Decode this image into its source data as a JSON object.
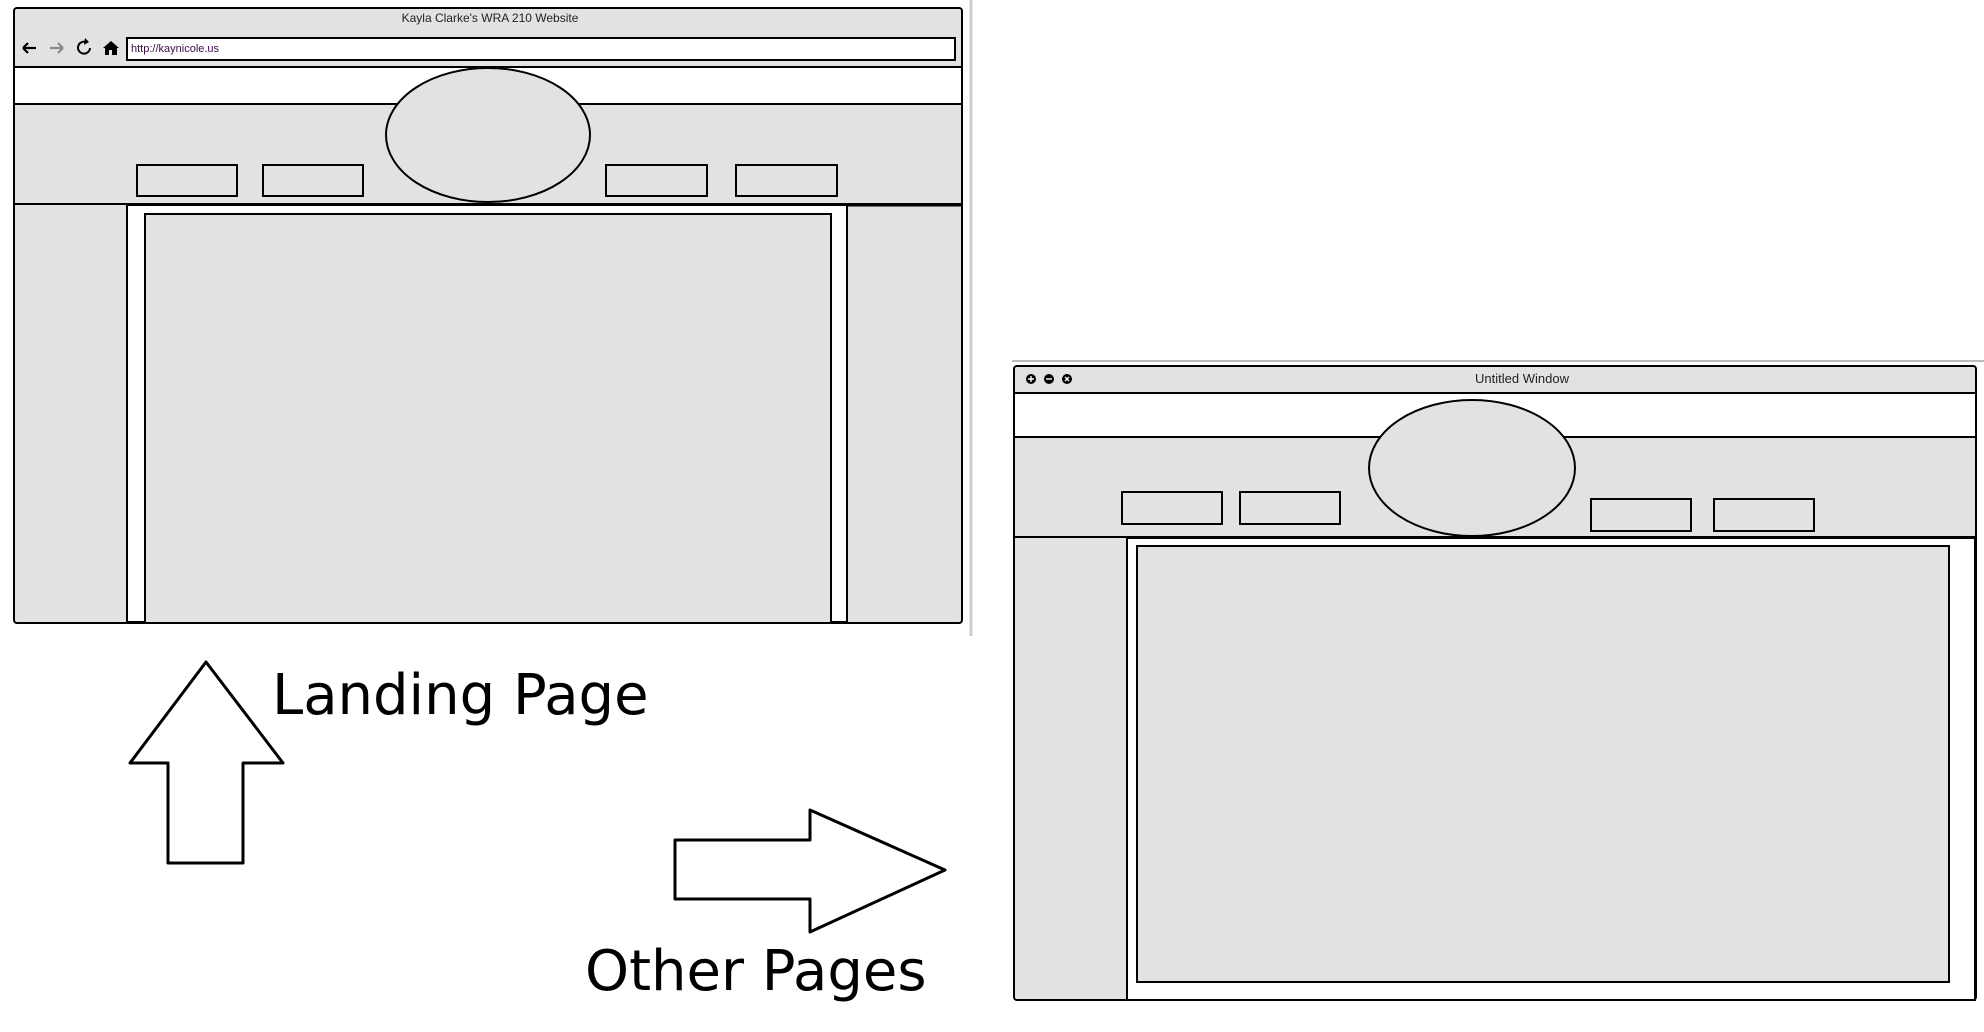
{
  "landing": {
    "window_title": "Kayla Clarke's WRA 210 Website",
    "url": "http://kaynicole.us",
    "nav": {
      "back": "back-arrow-icon",
      "forward": "forward-arrow-icon",
      "reload": "reload-icon",
      "home": "home-icon"
    }
  },
  "other": {
    "window_title": "Untitled Window",
    "controls": [
      "plus-icon",
      "minus-icon",
      "close-icon"
    ]
  },
  "labels": {
    "landing_page": "Landing Page",
    "other_pages": "Other Pages"
  },
  "colors": {
    "fill": "#e2e2e2",
    "stroke": "#000000",
    "background": "#ffffff"
  }
}
